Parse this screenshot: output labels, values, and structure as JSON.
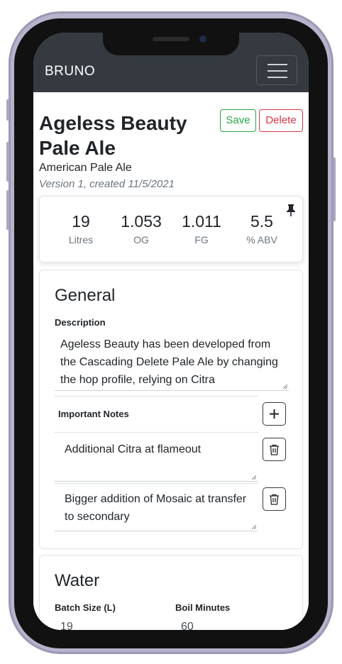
{
  "navbar": {
    "brand": "BRUNO"
  },
  "recipe": {
    "title": "Ageless Beauty Pale Ale",
    "style": "American Pale Ale",
    "version_info": "Version 1, created 11/5/2021",
    "save_label": "Save",
    "delete_label": "Delete"
  },
  "stats": [
    {
      "value": "19",
      "label": "Litres"
    },
    {
      "value": "1.053",
      "label": "OG"
    },
    {
      "value": "1.011",
      "label": "FG"
    },
    {
      "value": "5.5",
      "label": "% ABV"
    }
  ],
  "general": {
    "heading": "General",
    "description_label": "Description",
    "description": "Ageless Beauty has been developed from the Cascading Delete Pale Ale by changing the hop profile, relying on Citra",
    "notes_label": "Important Notes",
    "notes": [
      "Additional Citra at flameout",
      "Bigger addition of Mosaic at transfer to secondary"
    ]
  },
  "water": {
    "heading": "Water",
    "batch_size_label": "Batch Size (L)",
    "batch_size": "19",
    "boil_minutes_label": "Boil Minutes",
    "boil_minutes": "60"
  },
  "colors": {
    "navbar": "#343a40",
    "save": "#28a745",
    "delete": "#dc3545",
    "phone_frame": "#b7b3cc"
  },
  "icons": [
    "hamburger-icon",
    "pin-icon",
    "plus-icon",
    "trash-icon"
  ]
}
